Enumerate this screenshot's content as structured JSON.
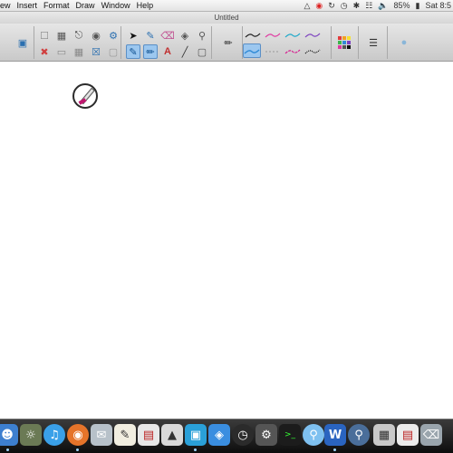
{
  "menubar": {
    "items": [
      "ew",
      "Insert",
      "Format",
      "Draw",
      "Window",
      "Help"
    ],
    "battery": "85%",
    "clock": "Sat 8:5"
  },
  "window": {
    "title": "Untitled"
  },
  "toolbar": {
    "pen_colors": [
      "#1a1a1a",
      "#e0359f",
      "#18a7c9",
      "#7b3fbf",
      "#2f8ad6",
      "#d51f8f",
      "#111111"
    ],
    "selected_tool": "pen-tool"
  },
  "dock": {
    "apps": [
      "finder-icon",
      "photos-icon",
      "itunes-icon",
      "firefox-icon",
      "mail-icon",
      "textedit-icon",
      "calendar-icon",
      "app-store-icon",
      "preview-icon",
      "dashboard-icon",
      "activity-monitor-icon",
      "messages-icon",
      "word-icon",
      "search-icon",
      "disk-utility-icon",
      "trash-icon"
    ]
  }
}
